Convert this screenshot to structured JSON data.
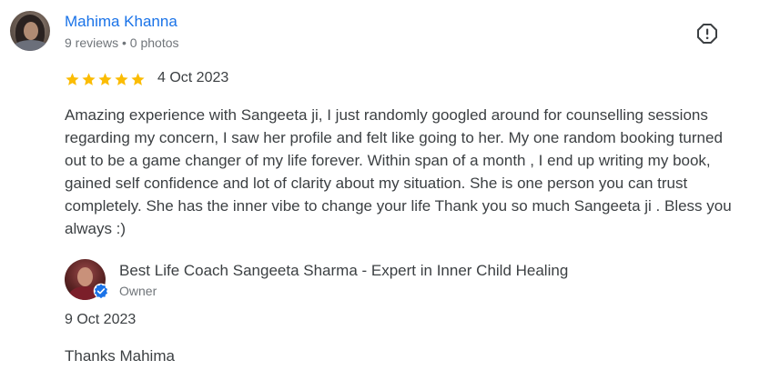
{
  "review": {
    "reviewer_name": "Mahima Khanna",
    "reviewer_meta": "9 reviews • 0 photos",
    "rating": 5,
    "max_rating": 5,
    "date": "4 Oct 2023",
    "text": "Amazing experience with Sangeeta ji, I just randomly googled around for counselling sessions regarding my concern, I saw her profile and felt like going to her. My one random booking turned out to be a game changer of my life forever. Within span of a month , I end up writing my book, gained self confidence and lot of clarity about my situation. She is one person you can trust completely. She has the inner vibe to change your life Thank you so much Sangeeta ji . Bless you always :)",
    "report_icon": "report-flag-icon"
  },
  "owner_reply": {
    "owner_name": "Best Life Coach Sangeeta Sharma - Expert in Inner Child Healing",
    "owner_role": "Owner",
    "date": "9 Oct 2023",
    "text": "Thanks Mahima",
    "badge_icon": "verified-check-icon"
  },
  "colors": {
    "star": "#fbbc04",
    "link": "#1a73e8",
    "text": "#3c4043",
    "meta": "#70757a",
    "badge": "#1a73e8"
  }
}
